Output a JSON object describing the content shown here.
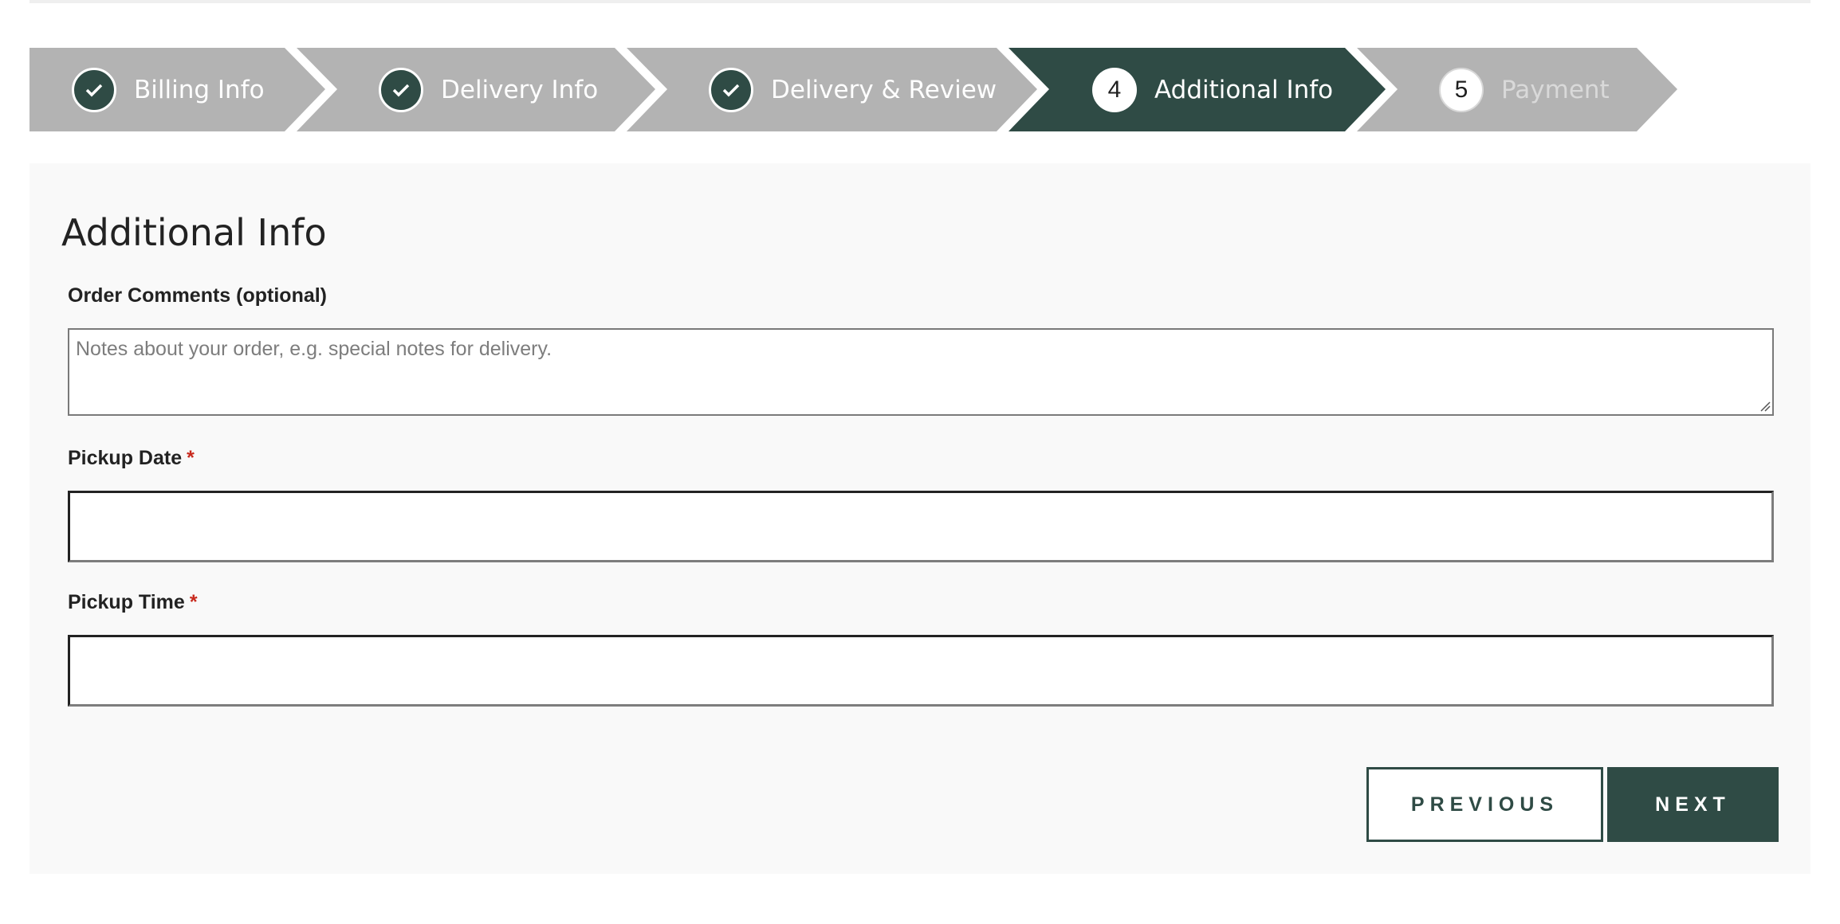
{
  "colors": {
    "accent": "#2f4b45",
    "step_inactive": "#b3b3b3",
    "panel_bg": "#f9f9f9",
    "required": "#c8291d"
  },
  "steps": [
    {
      "label": "Billing Info",
      "status": "completed",
      "icon": "check-icon"
    },
    {
      "label": "Delivery Info",
      "status": "completed",
      "icon": "check-icon"
    },
    {
      "label": "Delivery & Review",
      "status": "completed",
      "icon": "check-icon"
    },
    {
      "label": "Additional Info",
      "status": "active",
      "number": "4"
    },
    {
      "label": "Payment",
      "status": "pending",
      "number": "5"
    }
  ],
  "form": {
    "title": "Additional Info",
    "order_comments": {
      "label": "Order Comments (optional)",
      "placeholder": "Notes about your order, e.g. special notes for delivery.",
      "value": ""
    },
    "pickup_date": {
      "label": "Pickup Date",
      "required_mark": "*",
      "value": ""
    },
    "pickup_time": {
      "label": "Pickup Time",
      "required_mark": "*",
      "value": ""
    }
  },
  "buttons": {
    "previous": "PREVIOUS",
    "next": "NEXT"
  }
}
